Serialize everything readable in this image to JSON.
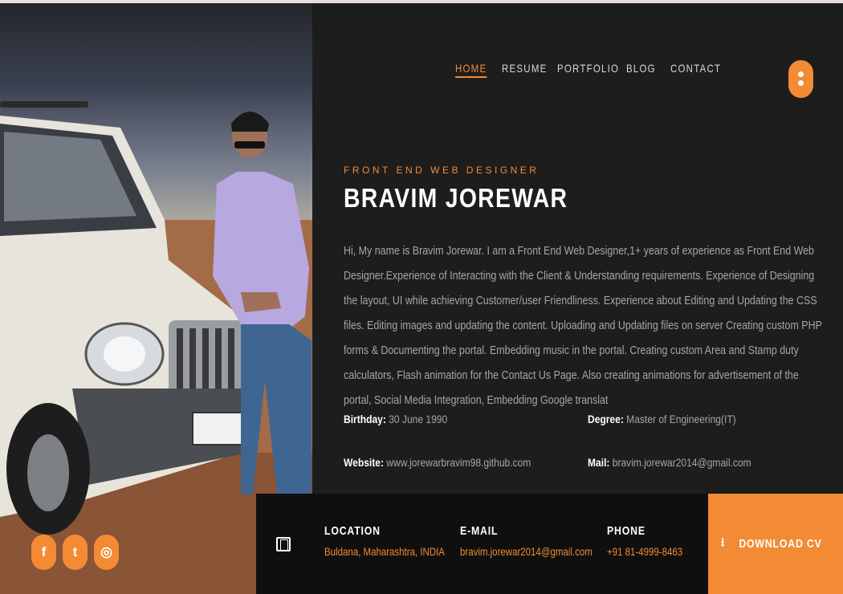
{
  "nav": {
    "items": [
      {
        "label": "HOME",
        "active": true
      },
      {
        "label": "RESUME",
        "active": false
      },
      {
        "label": "PORTFOLIO",
        "active": false
      },
      {
        "label": "BLOG",
        "active": false
      },
      {
        "label": "CONTACT",
        "active": false
      }
    ],
    "menu_icon": "dots-menu-icon"
  },
  "hero": {
    "subtitle": "FRONT END WEB DESIGNER",
    "name": "BRAVIM JOREWAR",
    "bio": "Hi, My name is Bravim Jorewar. I am a Front End Web Designer,1+ years of experience as Front End Web Designer.Experience of Interacting with the Client & Understanding requirements. Experience of Designing the layout, UI while achieving Customer/user Friendliness. Experience about Editing and Updating the CSS files. Editing images and updating the content. Uploading and Updating files on server Creating custom PHP forms & Documenting the portal. Embedding music in the portal. Creating custom Area and Stamp duty calculators, Flash animation for the Contact Us Page. Also creating animations for advertisement of the portal, Social Media Integration, Embedding Google translat"
  },
  "info": {
    "birthday_label": "Birthday:",
    "birthday": "30 June 1990",
    "degree_label": "Degree:",
    "degree": "Master of Engineering(IT)",
    "website_label": "Website:",
    "website": "www.jorewarbravim98.github.com",
    "mail_label": "Mail:",
    "mail": "bravim.jorewar2014@gmail.com"
  },
  "contact": {
    "location_label": "LOCATION",
    "location": "Buldana, Maharashtra, INDIA",
    "email_label": "E-MAIL",
    "email": "bravim.jorewar2014@gmail.com",
    "phone_label": "PHONE",
    "phone": "+91 81-4999-8463"
  },
  "download": {
    "label": "DOWNLOAD CV",
    "icon": "download-icon"
  },
  "social": [
    {
      "name": "facebook-icon",
      "glyph": "f"
    },
    {
      "name": "twitter-icon",
      "glyph": "t"
    },
    {
      "name": "instagram-icon",
      "glyph": "◎"
    }
  ],
  "colors": {
    "accent": "#f38b35",
    "background": "#1d1d1d",
    "bar": "#0f0f0f"
  }
}
